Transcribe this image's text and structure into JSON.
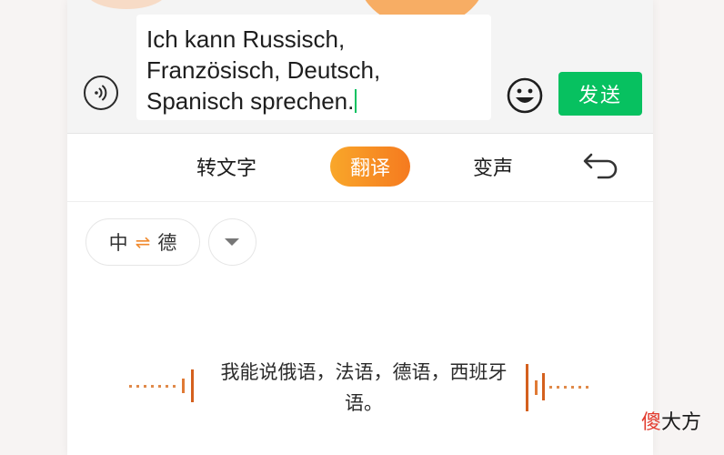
{
  "input": {
    "text": "Ich kann Russisch,\nFranzösisch, Deutsch,\nSpanisch sprechen."
  },
  "buttons": {
    "send": "发送",
    "voice_icon": "voice-input-icon",
    "emoji_icon": "emoji-icon"
  },
  "tools": {
    "to_text": "转文字",
    "translate": "翻译",
    "change_voice": "变声",
    "back_icon": "undo-back-icon"
  },
  "language": {
    "source": "中",
    "swap_symbol": "⇌",
    "target": "德"
  },
  "translation": {
    "text": "我能说俄语，法语，德语，西班牙语。"
  },
  "watermark": {
    "first": "傻",
    "rest": "大方"
  },
  "colors": {
    "accent_green": "#07c160",
    "accent_orange": "#f57a1f"
  }
}
